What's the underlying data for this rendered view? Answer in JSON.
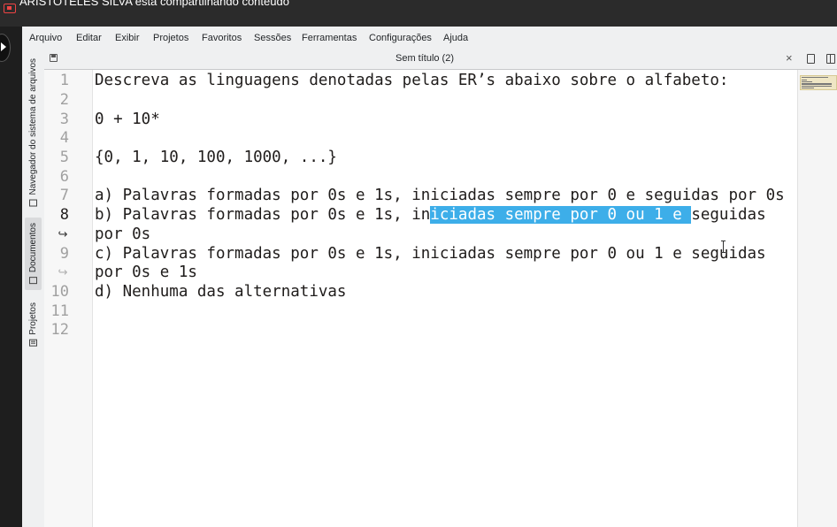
{
  "share_banner": {
    "text": "ARISTOTELES SILVA está compartilhando conteúdo",
    "icon": "screen-share-icon"
  },
  "menubar": {
    "items": [
      "Arquivo",
      "Editar",
      "Exibir",
      "Projetos",
      "Favoritos",
      "Sessões",
      "Ferramentas",
      "Configurações",
      "Ajuda"
    ]
  },
  "side_panel": {
    "tabs": [
      {
        "label": "Navegador do sistema de arquivos",
        "icon": "folder-icon",
        "active": false
      },
      {
        "label": "Documentos",
        "icon": "document-icon",
        "active": true
      },
      {
        "label": "Projetos",
        "icon": "project-icon",
        "active": false
      }
    ]
  },
  "tab": {
    "title": "Sem título (2)",
    "close_symbol": "×"
  },
  "editor": {
    "current_line": "8",
    "line_numbers": [
      "1",
      "2",
      "3",
      "4",
      "5",
      "6",
      "7",
      "8",
      "9",
      "10",
      "11",
      "12"
    ],
    "wrap_symbol": "↪",
    "lines": {
      "l1": "Descreva as linguagens denotadas pelas ER’s abaixo sobre o alfabeto:",
      "l3": "0 + 10*",
      "l5": "{0, 1, 10, 100, 1000, ...}",
      "l7": "a) Palavras formadas por 0s e 1s, iniciadas sempre por 0 e seguidas por 0s",
      "l8_before": "b) Palavras formadas por 0s e 1s, in",
      "l8_selected": "iciadas sempre por 0 ou 1 e ",
      "l8_after": "seguidas",
      "l8_wrap": "por 0s",
      "l9": "c) Palavras formadas por 0s e 1s, iniciadas sempre por 0 ou 1 e seguidas",
      "l9_wrap": "por 0s e 1s",
      "l10": "d) Nenhuma das alternativas"
    },
    "colors": {
      "selection": "#3daee9",
      "text": "#1f1c1b",
      "line_number": "#a0a0a0"
    }
  }
}
